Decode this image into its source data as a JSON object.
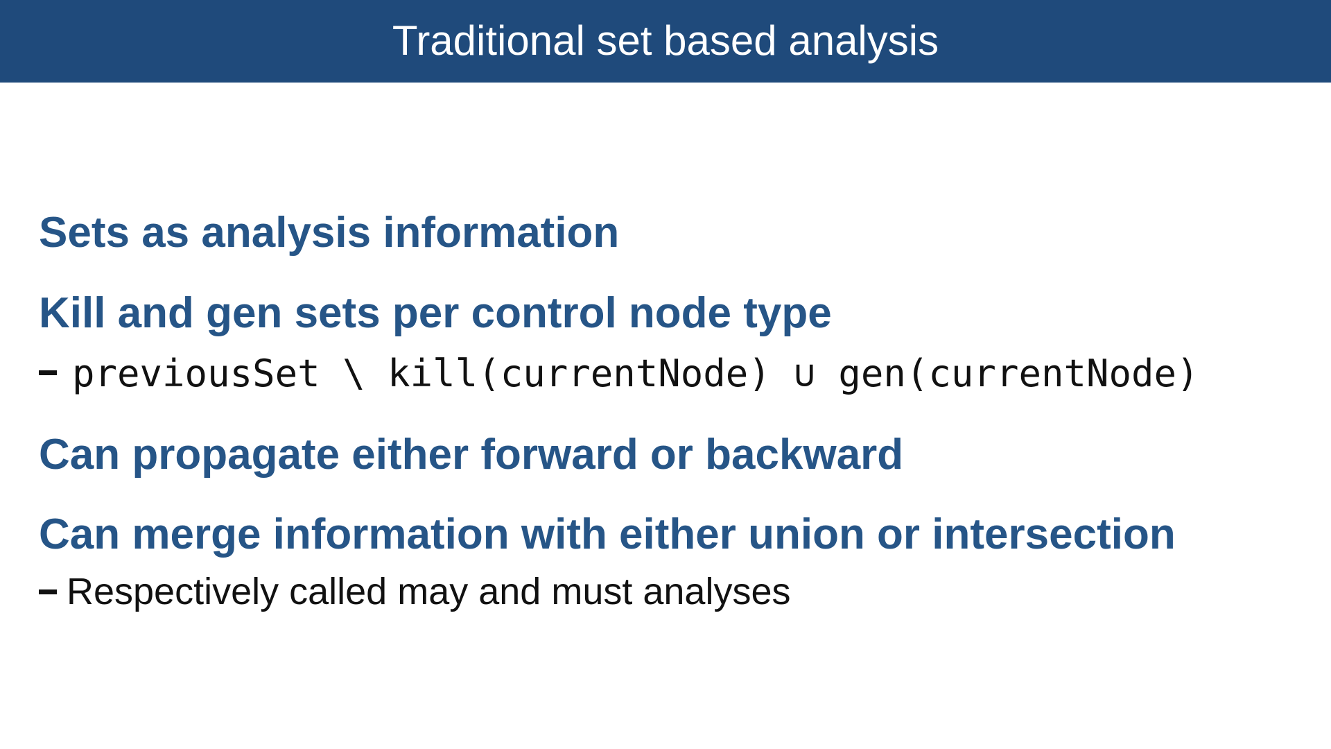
{
  "title": "Traditional set based analysis",
  "points": [
    {
      "text": "Sets as analysis information"
    },
    {
      "text": "Kill and gen sets per control node type",
      "sub": "previousSet \\ kill(currentNode) ∪ gen(currentNode)"
    },
    {
      "text": "Can propagate either forward or backward"
    },
    {
      "text": "Can merge information with either union or intersection",
      "sub": "Respectively called may and must analyses"
    }
  ],
  "colors": {
    "title_bar": "#1f4a7b",
    "title_text": "#ffffff",
    "heading": "#265587",
    "body": "#111111"
  }
}
